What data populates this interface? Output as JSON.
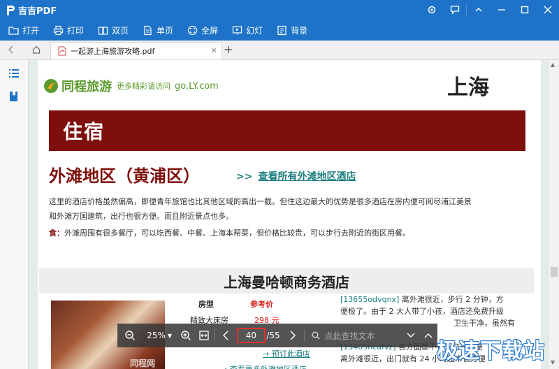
{
  "app": {
    "title": "吉吉PDF"
  },
  "toolbar": {
    "open_label": "打开",
    "print_label": "打印",
    "double_label": "双页",
    "single_label": "单页",
    "fullscreen_label": "全屏",
    "slideshow_label": "幻灯",
    "background_label": "背景"
  },
  "tabs": [
    {
      "label": "一起游上海旅游攻略.pdf"
    }
  ],
  "document": {
    "brand_name": "同程旅游",
    "brand_sub": "更多精彩请访问",
    "brand_url": "go.LY.com",
    "city": "上海",
    "section_title": "住宿",
    "district_title": "外滩地区（黄浦区）",
    "district_link_arrow": ">>",
    "district_link": "查看所有外滩地区酒店",
    "para1_line1": "这里的酒店价格虽然偏高，即便青年旅馆也比其他区域的高出一截。但住这边最大的优势是很多酒店在房内便可阅尽浦江美景",
    "para1_line2": "和外滩万国建筑，出行也很方便。而且附近景点也多。",
    "food_label": "食：",
    "food_text": "外滩周围有很多餐厅，可以吃西餐、中餐、上海本帮菜，但价格比较贵，可以步行去附近的街区用餐。",
    "hotel_name": "上海曼哈顿商务酒店",
    "photo_watermark": "同程网",
    "room_header": "房型",
    "price_header": "参考价",
    "room1": "精致大床房",
    "price1": "298 元",
    "book_link": "→ 预订此酒店",
    "more_link": "→ 查看更多外滩地区酒店",
    "review1_id": "[13655odvqnx]",
    "review1_text_a": " 离外滩很近，步行 2 分钟，方",
    "review1_text_b": "便极了。由于 2 大人带了小孩，酒店还免费升级",
    "review1_text_c": "卫生干净，虽然有",
    "review2_id": "[13405ncafvz]",
    "review2_text_a": " 各方面都不错，交通很便",
    "review2_text_b": "离外滩很近，出门就有 24 小时超市很方便"
  },
  "viewer": {
    "zoom": "25%",
    "current_page": "40",
    "total_pages": "/55",
    "search_placeholder": "点此查找文本"
  },
  "watermark": "极速下载站",
  "colors": {
    "accent": "#1e73c8",
    "banner": "#7e0f0c",
    "link": "#1a7e7e",
    "price": "#d81e1e",
    "brand": "#5a9a2c",
    "highlight": "#e03030"
  }
}
